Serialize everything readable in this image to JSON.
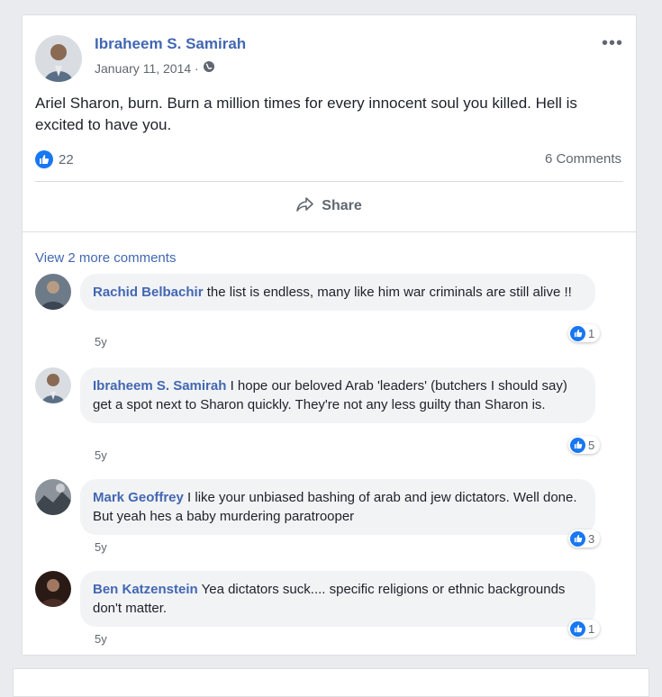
{
  "post": {
    "author": "Ibraheem S. Samirah",
    "date": "January 11, 2014 ·",
    "audience_icon": "globe-icon",
    "more_label": "•••",
    "text": "Ariel Sharon, burn. Burn a million times for every innocent soul you killed. Hell is excited to have you.",
    "like_count": "22",
    "comments_count": "6 Comments",
    "share_label": "Share"
  },
  "comments_section": {
    "view_more": "View 2 more comments",
    "comments": [
      {
        "author": "Rachid Belbachir",
        "text": " the list is endless, many like him war criminals are still alive !!",
        "age": "5y",
        "likes": "1"
      },
      {
        "author": "Ibraheem S. Samirah",
        "text": " I hope our beloved Arab 'leaders' (butchers I should say) get a spot next to Sharon quickly. They're not any less guilty than Sharon is.",
        "age": "5y",
        "likes": "5"
      },
      {
        "author": "Mark Geoffrey",
        "text": " I like your unbiased bashing of arab and jew dictators. Well done. But yeah hes a baby murdering paratrooper",
        "age": "5y",
        "likes": "3"
      },
      {
        "author": "Ben Katzenstein",
        "text": " Yea dictators suck.... specific religions or ethnic backgrounds don't matter.",
        "age": "5y",
        "likes": "1"
      }
    ]
  },
  "colors": {
    "link": "#4267b2",
    "like": "#1877f2",
    "bubble": "#f2f3f5"
  }
}
